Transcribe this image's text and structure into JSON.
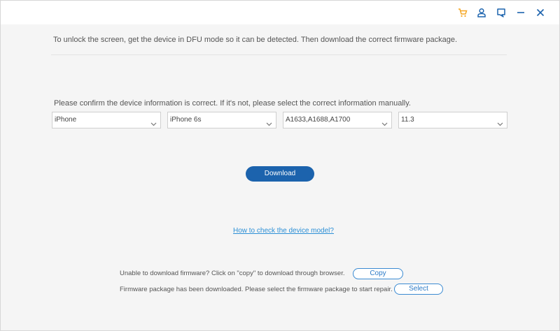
{
  "titlebar": {
    "icons": [
      "cart-icon",
      "user-icon",
      "feedback-icon",
      "minimize-icon",
      "close-icon"
    ],
    "accent_color": "#f5a623",
    "icon_color": "#1c63ad"
  },
  "main": {
    "instruction": "To unlock the screen, get the device in DFU mode so it can be detected.  Then download the correct firmware package.",
    "confirm_text": "Please confirm the device information is correct. If it's not, please select the correct information manually.",
    "selects": [
      {
        "value": "iPhone"
      },
      {
        "value": "iPhone 6s"
      },
      {
        "value": "A1633,A1688,A1700"
      },
      {
        "value": "11.3"
      }
    ],
    "download_label": "Download",
    "help_link": "How to check the device model?",
    "copy_note": "Unable to download firmware? Click on \"copy\" to download through browser.",
    "copy_label": "Copy",
    "select_note": "Firmware package has been downloaded. Please select the firmware package to start repair.",
    "select_label": "Select",
    "button_color": "#1c63ad",
    "link_color": "#2b8fd6"
  }
}
